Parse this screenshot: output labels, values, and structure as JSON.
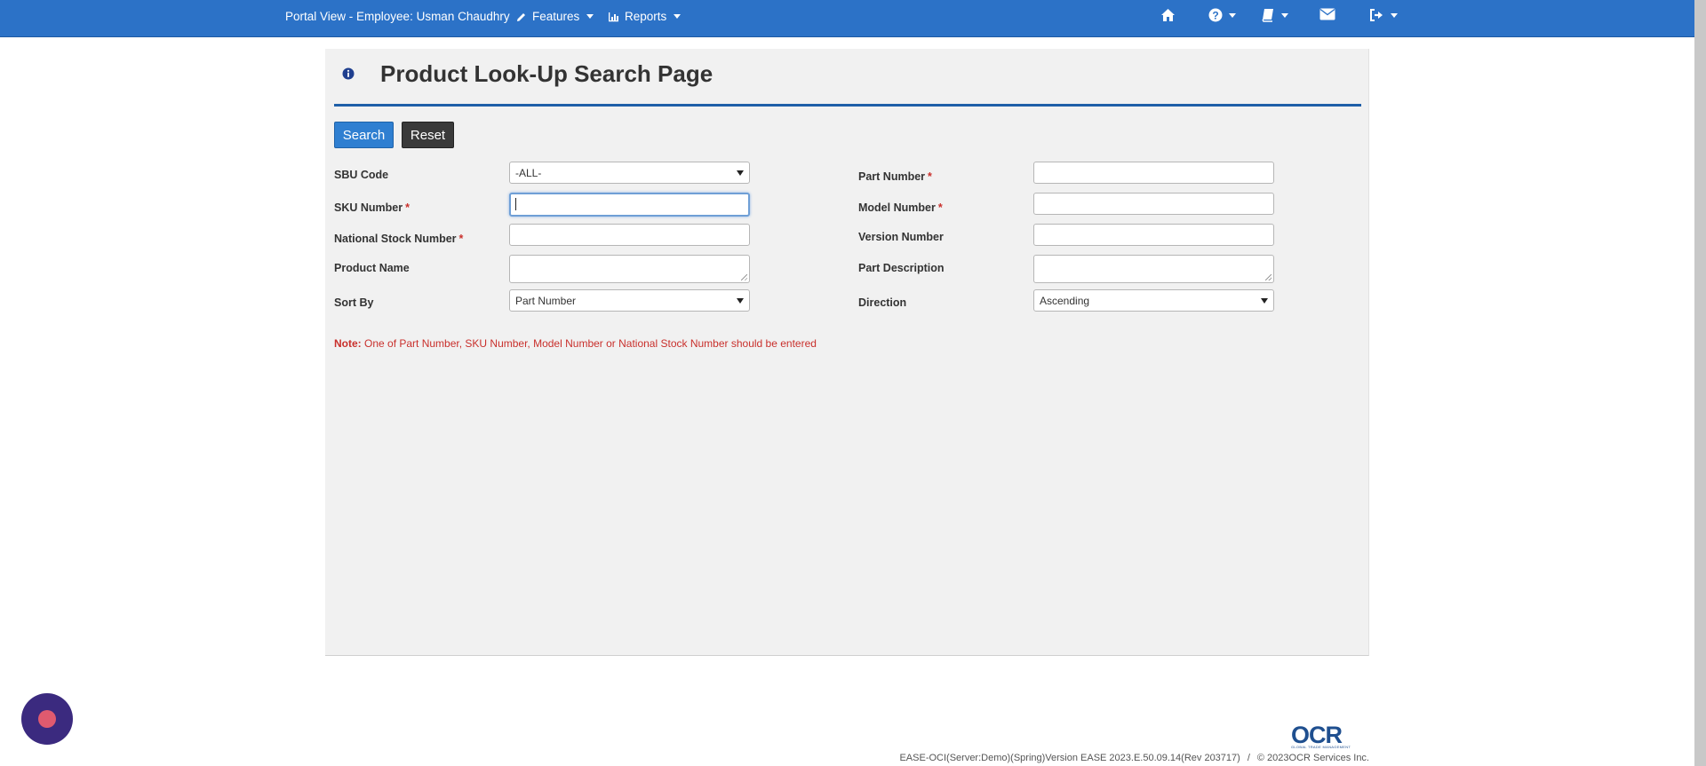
{
  "navbar": {
    "brand": "Portal View - Employee: Usman Chaudhry",
    "features_label": "Features",
    "reports_label": "Reports"
  },
  "page": {
    "title": "Product Look-Up Search Page"
  },
  "buttons": {
    "search": "Search",
    "reset": "Reset"
  },
  "form": {
    "sbu_code_label": "SBU Code",
    "sbu_code_value": "-ALL-",
    "sku_number_label": "SKU Number",
    "sku_number_value": "",
    "national_stock_number_label": "National Stock Number",
    "national_stock_number_value": "",
    "product_name_label": "Product Name",
    "product_name_value": "",
    "sort_by_label": "Sort By",
    "sort_by_value": "Part Number",
    "part_number_label": "Part Number",
    "part_number_value": "",
    "model_number_label": "Model Number",
    "model_number_value": "",
    "version_number_label": "Version Number",
    "version_number_value": "",
    "part_description_label": "Part Description",
    "part_description_value": "",
    "direction_label": "Direction",
    "direction_value": "Ascending",
    "required_marker": "*"
  },
  "note": {
    "prefix": "Note:",
    "text": " One of Part Number, SKU Number, Model Number or National Stock Number should be entered"
  },
  "footer": {
    "logo_text": "OCR",
    "logo_subtext": "GLOBAL TRADE MANAGEMENT",
    "version_text": "EASE-OCI(Server:Demo)(Spring)Version EASE 2023.E.50.09.14(Rev 203717)",
    "separator": "/",
    "copyright": "© 2023OCR Services Inc."
  },
  "icons": {
    "info": "info-icon",
    "home": "home-icon",
    "help": "help-icon",
    "book": "book-icon",
    "mail": "envelope-icon",
    "logout": "sign-out-icon",
    "pencil": "pencil-icon",
    "chart": "bar-chart-icon"
  },
  "colors": {
    "navbar": "#2c72c7",
    "title_rule": "#1f5fa8",
    "search_button": "#2f7fd1",
    "reset_button": "#3a3a3a",
    "required": "#c9302c",
    "chat_bubble": "#3b2a7f"
  }
}
